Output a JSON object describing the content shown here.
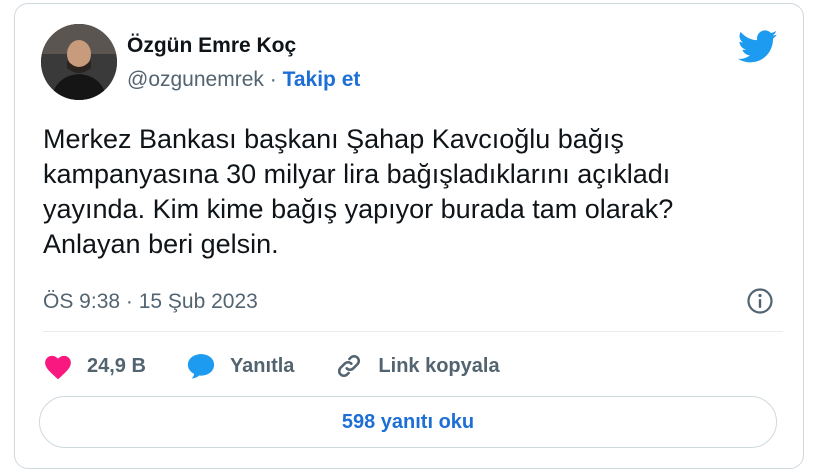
{
  "tweet": {
    "author": {
      "name": "Özgün Emre Koç",
      "handle": "@ozgunemrek",
      "separator": "·",
      "follow_label": "Takip et"
    },
    "text": "Merkez Bankası başkanı Şahap Kavcıoğlu bağış\nkampanyasına 30 milyar lira bağışladıklarını açıkladı\nyayında. Kim kime bağış yapıyor burada tam olarak?\nAnlayan beri gelsin.",
    "timestamp": "ÖS 9:38 · 15 Şub 2023",
    "actions": {
      "likes": "24,9 B",
      "reply_label": "Yanıtla",
      "copy_link_label": "Link kopyala"
    },
    "read_replies_label": "598 yanıtı oku"
  },
  "colors": {
    "accent": "#1d9bf0",
    "link": "#1d6fd6",
    "like": "#f91880",
    "muted": "#536471"
  },
  "icons": {
    "brand": "twitter-bird-icon",
    "info": "info-icon",
    "like": "heart-icon",
    "reply": "speech-bubble-icon",
    "copy_link": "link-icon"
  }
}
